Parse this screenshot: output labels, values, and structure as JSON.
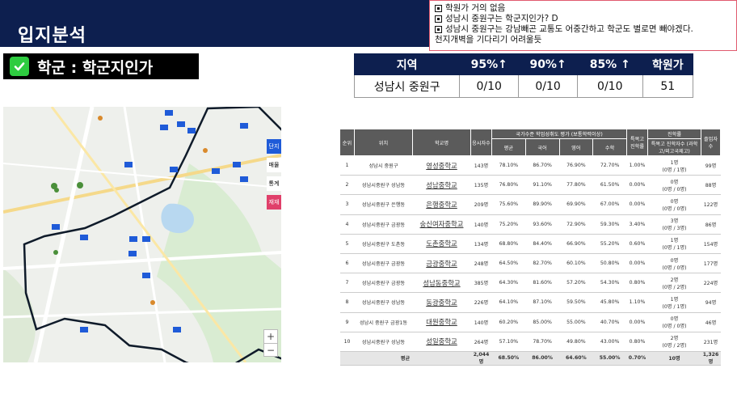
{
  "page": {
    "title": "입지분석"
  },
  "notes": [
    "학원가 거의 없음",
    "성남시 중원구는 학군지인가? D",
    "성남시 중원구는 강남빼곤 교통도 어중간하고 학군도 별로면 빼야겠다.",
    "천지개벽을 기다리기 어려울듯"
  ],
  "section": {
    "label": "학군 : 학군지인가"
  },
  "summary": {
    "headers": [
      "지역",
      "95%↑",
      "90%↑",
      "85% ↑",
      "학원가"
    ],
    "row": [
      "성남시 중원구",
      "0/10",
      "0/10",
      "0/10",
      "51"
    ]
  },
  "map": {
    "zoom_in": "+",
    "zoom_out": "−",
    "side_buttons": [
      "단지",
      "매물",
      "통계",
      "재재"
    ],
    "accent": "#1f5bd8",
    "boundary": "#0f1b2a"
  },
  "school_table": {
    "header_top": [
      "순위",
      "위치",
      "학교명",
      "응시자수",
      "국가수준 학업성취도 평가 (보통학력이상)",
      "특목고 진학률",
      "진학률",
      "졸업자수"
    ],
    "header_sub": [
      "평균",
      "국어",
      "영어",
      "수학",
      "특목고 진학자수 (과학고/외고국제고)"
    ],
    "rows": [
      [
        "1",
        "성남시 중원구",
        "영성중학교",
        "143명",
        "78.10%",
        "86.70%",
        "76.90%",
        "72.70%",
        "1.00%",
        "1명",
        "(0명 / 1명)",
        "99명"
      ],
      [
        "2",
        "성남시중원구 성남동",
        "성남중학교",
        "135명",
        "76.80%",
        "91.10%",
        "77.80%",
        "61.50%",
        "0.00%",
        "0명",
        "(0명 / 0명)",
        "88명"
      ],
      [
        "3",
        "성남시중원구 은행동",
        "은행중학교",
        "209명",
        "75.60%",
        "89.90%",
        "69.90%",
        "67.00%",
        "0.00%",
        "0명",
        "(0명 / 0명)",
        "122명"
      ],
      [
        "4",
        "성남시중원구 금광동",
        "숭신여자중학교",
        "140명",
        "75.20%",
        "93.60%",
        "72.90%",
        "59.30%",
        "3.40%",
        "3명",
        "(0명 / 3명)",
        "86명"
      ],
      [
        "5",
        "성남시중원구 도촌동",
        "도촌중학교",
        "134명",
        "68.80%",
        "84.40%",
        "66.90%",
        "55.20%",
        "0.60%",
        "1명",
        "(0명 / 1명)",
        "154명"
      ],
      [
        "6",
        "성남시중원구 금광동",
        "금광중학교",
        "248명",
        "64.50%",
        "82.70%",
        "60.10%",
        "50.80%",
        "0.00%",
        "0명",
        "(0명 / 0명)",
        "177명"
      ],
      [
        "7",
        "성남시중원구 금광동",
        "성남동중학교",
        "385명",
        "64.30%",
        "81.60%",
        "57.20%",
        "54.30%",
        "0.80%",
        "2명",
        "(0명 / 2명)",
        "224명"
      ],
      [
        "8",
        "성남시중원구 성남동",
        "동광중학교",
        "226명",
        "64.10%",
        "87.10%",
        "59.50%",
        "45.80%",
        "1.10%",
        "1명",
        "(0명 / 1명)",
        "94명"
      ],
      [
        "9",
        "성남시 중원구 금광1동",
        "대원중학교",
        "140명",
        "60.20%",
        "85.00%",
        "55.00%",
        "40.70%",
        "0.00%",
        "0명",
        "(0명 / 0명)",
        "46명"
      ],
      [
        "10",
        "성남시중원구 성남동",
        "성일중학교",
        "264명",
        "57.10%",
        "78.70%",
        "49.80%",
        "43.00%",
        "0.80%",
        "2명",
        "(0명 / 2명)",
        "231명"
      ]
    ],
    "avg": [
      "평균",
      "2,044명",
      "68.50%",
      "86.00%",
      "64.60%",
      "55.00%",
      "0.70%",
      "10명",
      "1,326명"
    ]
  }
}
